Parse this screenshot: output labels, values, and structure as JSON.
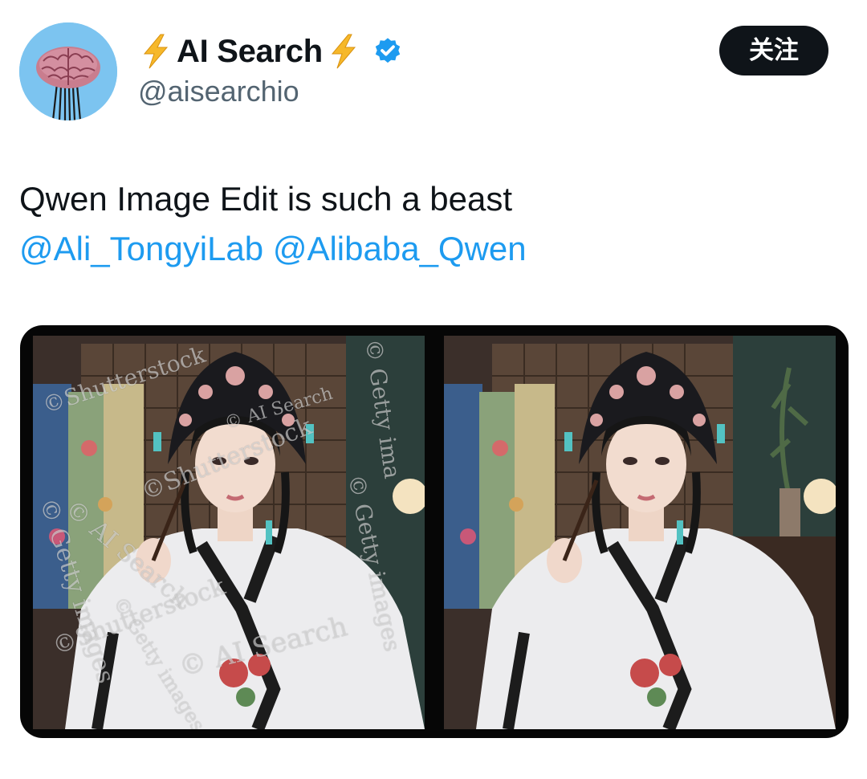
{
  "profile": {
    "display_name": "AI Search",
    "handle": "@aisearchio",
    "verified": true,
    "avatar_icon": "brain-icon",
    "name_decoration_icon": "lightning-bolt-icon"
  },
  "actions": {
    "follow_label": "关注"
  },
  "tweet": {
    "text": "Qwen Image Edit is such a beast",
    "mentions": [
      "@Ali_TongyiLab",
      "@Alibaba_Qwen"
    ]
  },
  "media": {
    "images": [
      {
        "description_icon": "photo-before-edit",
        "watermarks": [
          "©Shutterstock",
          "© AI Search",
          "©Shutterstock",
          "© AI Search",
          "© Getty images",
          "©Shutterstock",
          "© AI Search",
          "© Getty ima",
          "© Getty images",
          "© Getty images"
        ]
      },
      {
        "description_icon": "photo-after-edit",
        "watermarks": []
      }
    ]
  },
  "colors": {
    "link": "#1d9bf0",
    "text_primary": "#0f1419",
    "text_secondary": "#536471",
    "follow_button_bg": "#0f1419",
    "verified_badge": "#1d9bf0",
    "bolt": "#f6b82a",
    "avatar_bg": "#7cc4f0"
  }
}
